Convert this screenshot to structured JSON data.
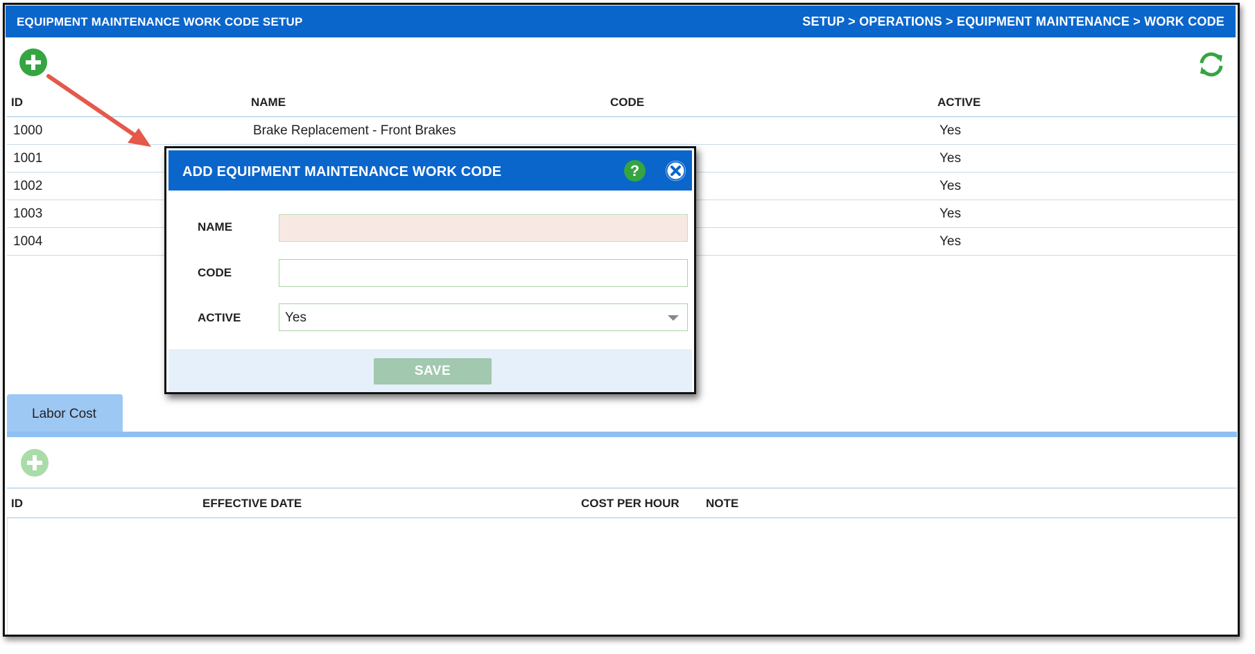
{
  "header": {
    "title": "EQUIPMENT MAINTENANCE WORK CODE SETUP",
    "breadcrumb": "SETUP > OPERATIONS > EQUIPMENT MAINTENANCE > WORK CODE"
  },
  "toolbar": {
    "add_icon": "plus-circle-icon",
    "refresh_icon": "refresh-icon"
  },
  "table": {
    "columns": [
      "ID",
      "NAME",
      "CODE",
      "ACTIVE"
    ],
    "rows": [
      {
        "id": "1000",
        "name": "Brake Replacement - Front Brakes",
        "code": "",
        "active": "Yes"
      },
      {
        "id": "1001",
        "name": "",
        "code": "",
        "active": "Yes"
      },
      {
        "id": "1002",
        "name": "",
        "code": "",
        "active": "Yes"
      },
      {
        "id": "1003",
        "name": "",
        "code": "",
        "active": "Yes"
      },
      {
        "id": "1004",
        "name": "",
        "code": "",
        "active": "Yes"
      }
    ]
  },
  "dialog": {
    "title": "ADD EQUIPMENT MAINTENANCE WORK CODE",
    "help_label": "?",
    "fields": {
      "name_label": "NAME",
      "name_value": "",
      "code_label": "CODE",
      "code_value": "",
      "active_label": "ACTIVE",
      "active_value": "Yes"
    },
    "save_label": "SAVE"
  },
  "lower": {
    "tab_label": "Labor Cost",
    "columns": [
      "ID",
      "EFFECTIVE DATE",
      "COST PER HOUR",
      "NOTE"
    ]
  },
  "colors": {
    "primary": "#0b66cc",
    "add_green": "#35a542",
    "save_disabled": "#a2c8b0",
    "annotation_arrow": "#e5584a"
  }
}
